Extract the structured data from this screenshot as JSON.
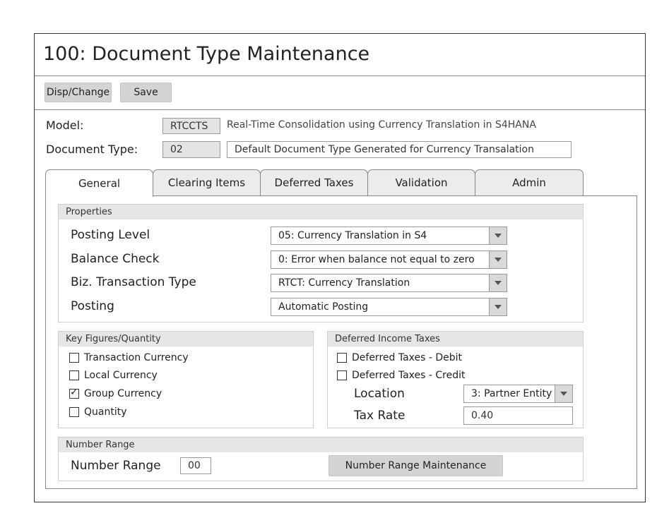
{
  "window": {
    "title": "100: Document Type Maintenance"
  },
  "toolbar": {
    "disp_change_label": "Disp/Change",
    "save_label": "Save"
  },
  "header": {
    "model_label": "Model:",
    "model_value": "RTCCTS",
    "model_desc": "Real-Time Consolidation using Currency Translation in S4HANA",
    "doctype_label": "Document Type:",
    "doctype_value": "02",
    "doctype_desc": "Default Document Type Generated for Currency Transalation"
  },
  "tabs": [
    {
      "label": "General",
      "active": true
    },
    {
      "label": "Clearing Items",
      "active": false
    },
    {
      "label": "Deferred Taxes",
      "active": false
    },
    {
      "label": "Validation",
      "active": false
    },
    {
      "label": "Admin",
      "active": false
    }
  ],
  "properties": {
    "title": "Properties",
    "rows": [
      {
        "label": "Posting Level",
        "value": "05: Currency Translation in S4"
      },
      {
        "label": "Balance Check",
        "value": "0: Error when balance not equal to zero"
      },
      {
        "label": "Biz. Transaction Type",
        "value": "RTCT: Currency Translation"
      },
      {
        "label": "Posting",
        "value": "Automatic Posting"
      }
    ]
  },
  "key_figures": {
    "title": "Key Figures/Quantity",
    "items": [
      {
        "label": "Transaction Currency",
        "checked": false
      },
      {
        "label": "Local Currency",
        "checked": false
      },
      {
        "label": "Group Currency",
        "checked": true
      },
      {
        "label": "Quantity",
        "checked": false
      }
    ]
  },
  "deferred_income_taxes": {
    "title": "Deferred Income Taxes",
    "items": [
      {
        "label": "Deferred Taxes - Debit",
        "checked": false
      },
      {
        "label": "Deferred Taxes - Credit",
        "checked": false
      }
    ],
    "location_label": "Location",
    "location_value": "3: Partner Entity",
    "tax_rate_label": "Tax Rate",
    "tax_rate_value": "0.40"
  },
  "number_range": {
    "title": "Number Range",
    "label": "Number Range",
    "value": "00",
    "button_label": "Number Range Maintenance"
  }
}
